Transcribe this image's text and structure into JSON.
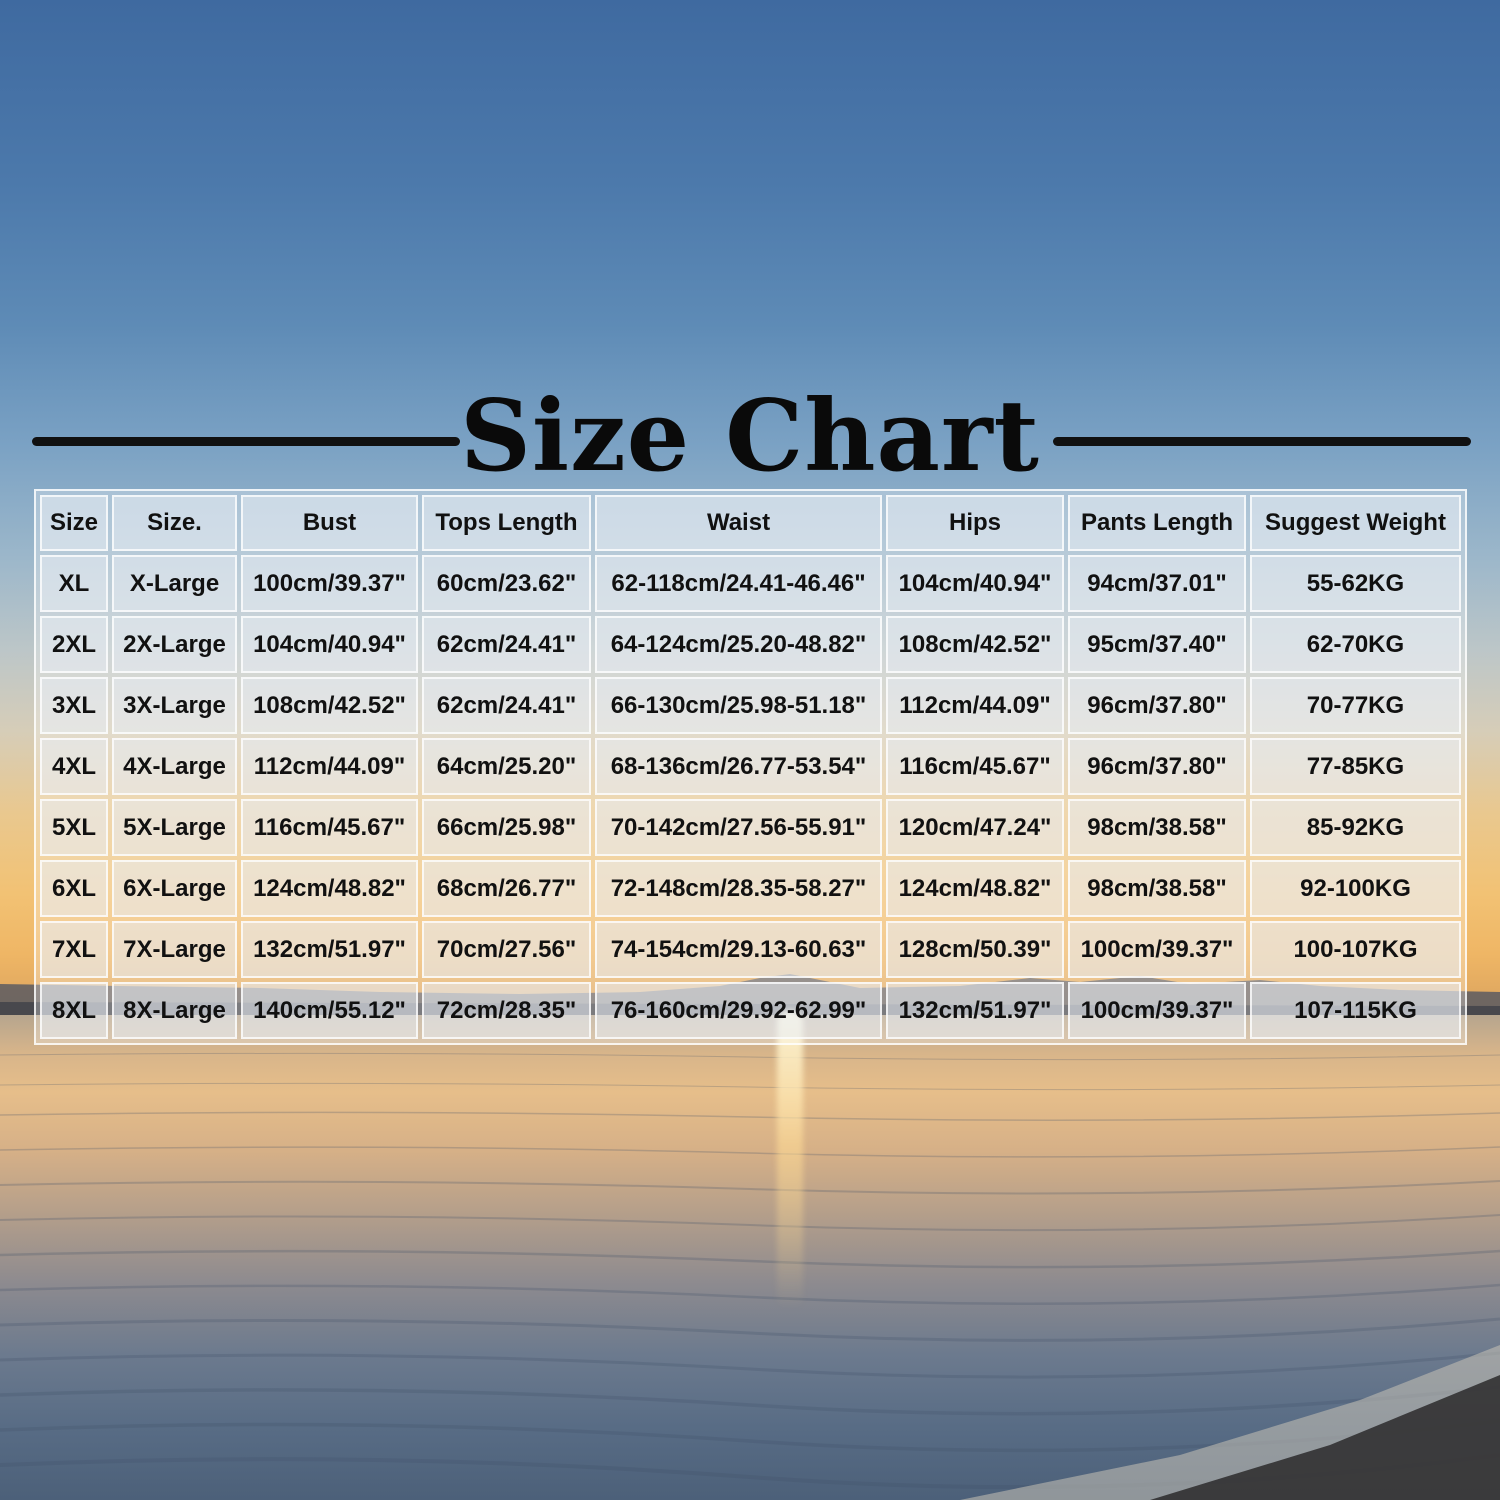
{
  "title": "Size Chart",
  "colors": {
    "title": "#0a0a0a",
    "cell_text": "#111111",
    "sky_top": "#3f6aa0",
    "horizon": "#f2c274",
    "sea": "#586c85"
  },
  "table": {
    "headers": [
      "Size",
      "Size.",
      "Bust",
      "Tops Length",
      "Waist",
      "Hips",
      "Pants Length",
      "Suggest Weight"
    ],
    "rows": [
      [
        "XL",
        "X-Large",
        "100cm/39.37\"",
        "60cm/23.62\"",
        "62-118cm/24.41-46.46\"",
        "104cm/40.94\"",
        "94cm/37.01\"",
        "55-62KG"
      ],
      [
        "2XL",
        "2X-Large",
        "104cm/40.94\"",
        "62cm/24.41\"",
        "64-124cm/25.20-48.82\"",
        "108cm/42.52\"",
        "95cm/37.40\"",
        "62-70KG"
      ],
      [
        "3XL",
        "3X-Large",
        "108cm/42.52\"",
        "62cm/24.41\"",
        "66-130cm/25.98-51.18\"",
        "112cm/44.09\"",
        "96cm/37.80\"",
        "70-77KG"
      ],
      [
        "4XL",
        "4X-Large",
        "112cm/44.09\"",
        "64cm/25.20\"",
        "68-136cm/26.77-53.54\"",
        "116cm/45.67\"",
        "96cm/37.80\"",
        "77-85KG"
      ],
      [
        "5XL",
        "5X-Large",
        "116cm/45.67\"",
        "66cm/25.98\"",
        "70-142cm/27.56-55.91\"",
        "120cm/47.24\"",
        "98cm/38.58\"",
        "85-92KG"
      ],
      [
        "6XL",
        "6X-Large",
        "124cm/48.82\"",
        "68cm/26.77\"",
        "72-148cm/28.35-58.27\"",
        "124cm/48.82\"",
        "98cm/38.58\"",
        "92-100KG"
      ],
      [
        "7XL",
        "7X-Large",
        "132cm/51.97\"",
        "70cm/27.56\"",
        "74-154cm/29.13-60.63\"",
        "128cm/50.39\"",
        "100cm/39.37\"",
        "100-107KG"
      ],
      [
        "8XL",
        "8X-Large",
        "140cm/55.12\"",
        "72cm/28.35\"",
        "76-160cm/29.92-62.99\"",
        "132cm/51.97\"",
        "100cm/39.37\"",
        "107-115KG"
      ]
    ]
  }
}
